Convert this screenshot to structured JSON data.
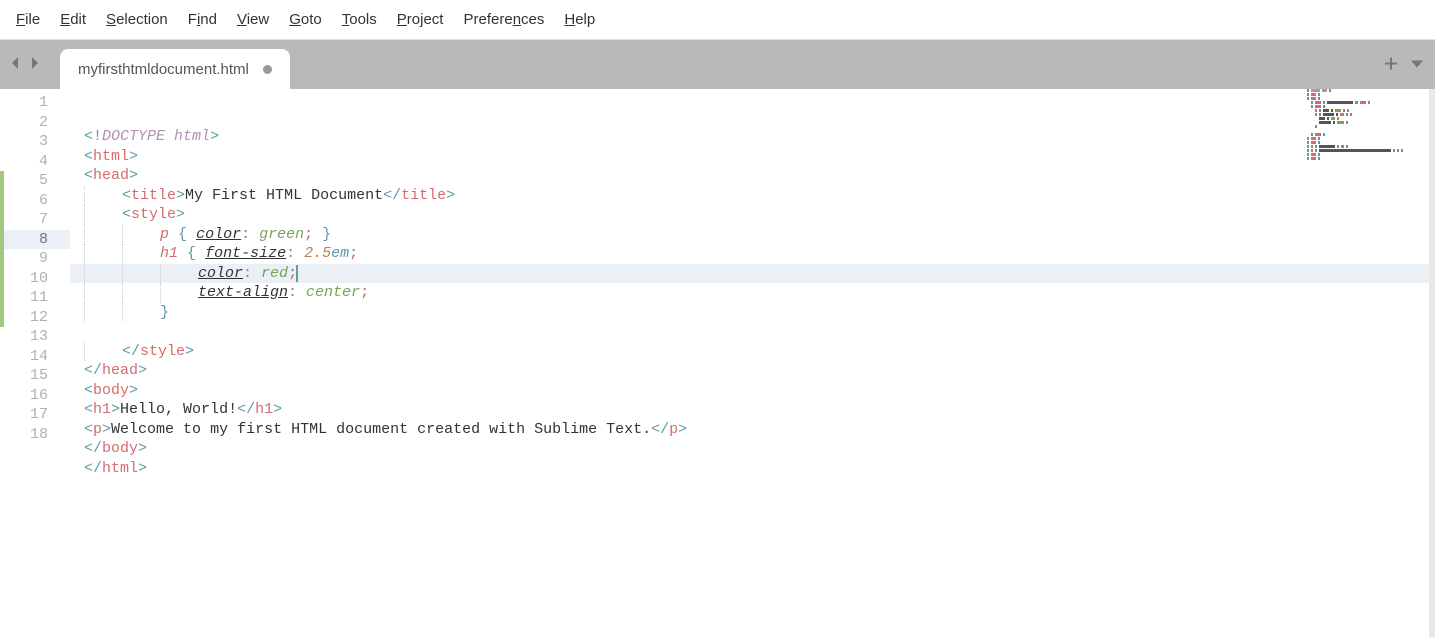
{
  "menu": {
    "items": [
      {
        "label": "File",
        "ul": "F",
        "rest": "ile"
      },
      {
        "label": "Edit",
        "ul": "E",
        "rest": "dit"
      },
      {
        "label": "Selection",
        "ul": "S",
        "rest": "election"
      },
      {
        "label": "Find",
        "ul": "i",
        "pre": "F",
        "rest": "nd"
      },
      {
        "label": "View",
        "ul": "V",
        "rest": "iew"
      },
      {
        "label": "Goto",
        "ul": "G",
        "rest": "oto"
      },
      {
        "label": "Tools",
        "ul": "T",
        "rest": "ools"
      },
      {
        "label": "Project",
        "ul": "P",
        "rest": "roject"
      },
      {
        "label": "Preferences",
        "ul": "n",
        "pre": "Prefere",
        "rest": "ces"
      },
      {
        "label": "Help",
        "ul": "H",
        "rest": "elp"
      }
    ]
  },
  "tab": {
    "filename": "myfirsthtmldocument.html",
    "dirty": true
  },
  "editor": {
    "current_line": 8,
    "line_count": 18,
    "modified_range": {
      "start": 5,
      "end": 12
    },
    "lines": {
      "1": {
        "tokens": [
          [
            "<!",
            "brkt"
          ],
          [
            "DOCTYPE",
            "doct"
          ],
          [
            " ",
            ""
          ],
          [
            "html",
            "doct"
          ],
          [
            ">",
            "brkt"
          ]
        ]
      },
      "2": {
        "tokens": [
          [
            "<",
            "brkt"
          ],
          [
            "html",
            "tag"
          ],
          [
            ">",
            "brkt"
          ]
        ]
      },
      "3": {
        "tokens": [
          [
            "<",
            "brkt"
          ],
          [
            "head",
            "tag"
          ],
          [
            ">",
            "brkt"
          ]
        ]
      },
      "4": {
        "indent": 1,
        "tokens": [
          [
            "<",
            "brkt"
          ],
          [
            "title",
            "tag"
          ],
          [
            ">",
            "brkt"
          ],
          [
            "My First HTML Document",
            "text"
          ],
          [
            "</",
            "brkt"
          ],
          [
            "title",
            "tag"
          ],
          [
            ">",
            "brkt"
          ]
        ]
      },
      "5": {
        "indent": 1,
        "tokens": [
          [
            "<",
            "brkt"
          ],
          [
            "style",
            "tag"
          ],
          [
            ">",
            "brkt"
          ]
        ]
      },
      "6": {
        "indent": 2,
        "tokens": [
          [
            "p",
            "sel"
          ],
          [
            " ",
            ""
          ],
          [
            "{",
            "brace"
          ],
          [
            " ",
            ""
          ],
          [
            "color",
            "prop"
          ],
          [
            ":",
            "punc"
          ],
          [
            " ",
            ""
          ],
          [
            "green",
            "val"
          ],
          [
            ";",
            "semi"
          ],
          [
            " ",
            ""
          ],
          [
            "}",
            "brace"
          ]
        ]
      },
      "7": {
        "indent": 2,
        "tokens": [
          [
            "h1",
            "sel"
          ],
          [
            " ",
            ""
          ],
          [
            "{",
            "brace"
          ],
          [
            " ",
            ""
          ],
          [
            "font-size",
            "prop"
          ],
          [
            ":",
            "punc"
          ],
          [
            " ",
            ""
          ],
          [
            "2.5",
            "num"
          ],
          [
            "em",
            "unit"
          ],
          [
            ";",
            "semi"
          ]
        ]
      },
      "8": {
        "indent": 3,
        "tokens": [
          [
            "color",
            "prop"
          ],
          [
            ":",
            "punc"
          ],
          [
            " ",
            ""
          ],
          [
            "red",
            "val"
          ],
          [
            ";",
            "semi"
          ]
        ],
        "cursor_after": true
      },
      "9": {
        "indent": 3,
        "tokens": [
          [
            "text-align",
            "prop"
          ],
          [
            ":",
            "punc"
          ],
          [
            " ",
            ""
          ],
          [
            "center",
            "val"
          ],
          [
            ";",
            "semi"
          ]
        ]
      },
      "10": {
        "indent": 2,
        "tokens": [
          [
            "}",
            "brace"
          ]
        ]
      },
      "11": {
        "indent": 0,
        "tokens": []
      },
      "12": {
        "indent": 1,
        "tokens": [
          [
            "</",
            "brkt"
          ],
          [
            "style",
            "tag"
          ],
          [
            ">",
            "brkt"
          ]
        ]
      },
      "13": {
        "tokens": [
          [
            "</",
            "brkt"
          ],
          [
            "head",
            "tag"
          ],
          [
            ">",
            "brkt"
          ]
        ]
      },
      "14": {
        "tokens": [
          [
            "<",
            "brkt"
          ],
          [
            "body",
            "tag"
          ],
          [
            ">",
            "brkt"
          ]
        ]
      },
      "15": {
        "tokens": [
          [
            "<",
            "brkt"
          ],
          [
            "h1",
            "tag"
          ],
          [
            ">",
            "brkt"
          ],
          [
            "Hello, World!",
            "text"
          ],
          [
            "</",
            "brkt"
          ],
          [
            "h1",
            "tag"
          ],
          [
            ">",
            "brkt"
          ]
        ]
      },
      "16": {
        "tokens": [
          [
            "<",
            "brkt"
          ],
          [
            "p",
            "tag"
          ],
          [
            ">",
            "brkt"
          ],
          [
            "Welcome to my first HTML document created with Sublime Text.",
            "text"
          ],
          [
            "</",
            "brkt"
          ],
          [
            "p",
            "tag"
          ],
          [
            ">",
            "brkt"
          ]
        ]
      },
      "17": {
        "tokens": [
          [
            "</",
            "brkt"
          ],
          [
            "body",
            "tag"
          ],
          [
            ">",
            "brkt"
          ]
        ]
      },
      "18": {
        "tokens": [
          [
            "</",
            "brkt"
          ],
          [
            "html",
            "tag"
          ],
          [
            ">",
            "brkt"
          ]
        ]
      }
    }
  }
}
